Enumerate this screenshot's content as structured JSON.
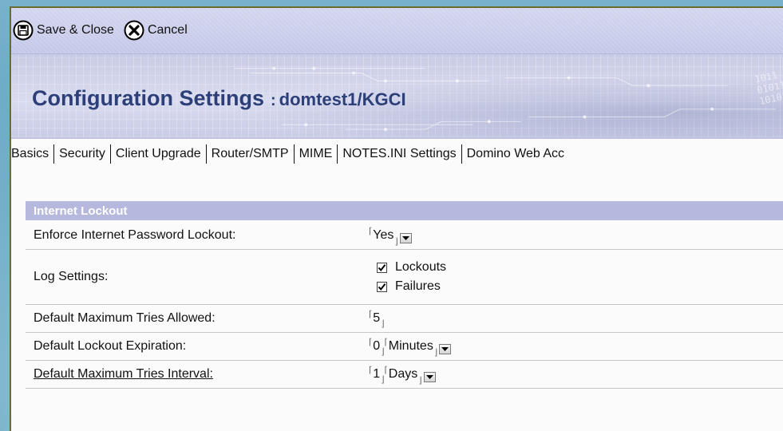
{
  "toolbar": {
    "save_close_label": "Save & Close",
    "cancel_label": "Cancel"
  },
  "banner": {
    "title": "Configuration Settings",
    "separator": ":",
    "server": "domtest1/KGCI"
  },
  "tabs": [
    {
      "label": "Basics"
    },
    {
      "label": "Security"
    },
    {
      "label": "Client Upgrade"
    },
    {
      "label": "Router/SMTP"
    },
    {
      "label": "MIME"
    },
    {
      "label": "NOTES.INI Settings"
    },
    {
      "label": "Domino Web Acc"
    }
  ],
  "section": {
    "title": "Internet Lockout",
    "rows": {
      "enforce": {
        "label": "Enforce Internet Password Lockout:",
        "value": "Yes"
      },
      "log": {
        "label": "Log Settings:",
        "options": [
          {
            "label": "Lockouts",
            "checked": true
          },
          {
            "label": "Failures",
            "checked": true
          }
        ]
      },
      "max_tries": {
        "label": "Default Maximum Tries Allowed:",
        "value": "5"
      },
      "expiration": {
        "label": "Default Lockout Expiration:",
        "value": "0",
        "unit": "Minutes"
      },
      "interval": {
        "label": "Default Maximum Tries Interval:",
        "value": "1",
        "unit": "Days"
      }
    }
  },
  "colors": {
    "header_bg": "#b6b9dd",
    "title_text": "#2d3f79",
    "toolbar_bg": "#c8cbea",
    "outer_bg": "#5fa0bd"
  },
  "icons": {
    "save": "save-icon",
    "cancel": "cancel-icon",
    "dropdown": "dropdown-arrow-icon",
    "checkbox": "checkbox-checked-icon"
  }
}
